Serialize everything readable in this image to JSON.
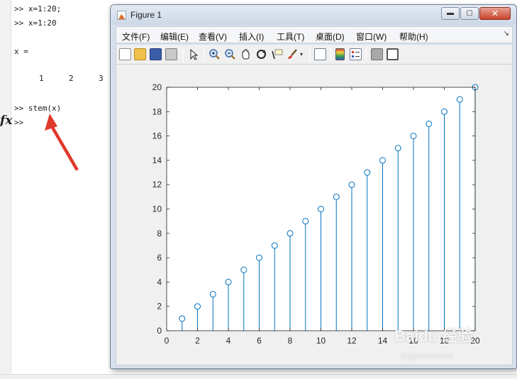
{
  "command_window": {
    "history": [
      ">> x=1:20;",
      ">> x=1:20"
    ],
    "var_label": "x =",
    "columns": [
      "1",
      "2",
      "3"
    ],
    "command": ">> stem(x)",
    "prompt": ">>",
    "fx_symbol": "fx"
  },
  "figure": {
    "title": "Figure 1",
    "min_glyph": "▬",
    "max_glyph": "▢",
    "close_glyph": "✕",
    "menus": [
      "文件(F)",
      "编辑(E)",
      "查看(V)",
      "插入(I)",
      "工具(T)",
      "桌面(D)",
      "窗口(W)",
      "帮助(H)"
    ],
    "dock_glyph": "↘",
    "toolbar_icons": [
      "new-figure-icon",
      "open-file-icon",
      "save-icon",
      "print-icon",
      "pointer-icon",
      "zoom-in-icon",
      "zoom-out-icon",
      "pan-hand-icon",
      "rotate-3d-icon",
      "data-cursor-icon",
      "brush-icon",
      "link-plot-icon",
      "colorbar-icon",
      "legend-icon",
      "hide-tools-icon",
      "show-tools-icon"
    ]
  },
  "watermark": {
    "text": "Baidu 经验",
    "sub": "jingyan.baidu.com"
  },
  "colors": {
    "stem": "#0072BD",
    "arrow": "#e0392b",
    "axes_bg": "#ffffff",
    "figure_bg": "#f0f0f0"
  },
  "chart_data": {
    "type": "stem",
    "title": "",
    "xlabel": "",
    "ylabel": "",
    "x": [
      1,
      2,
      3,
      4,
      5,
      6,
      7,
      8,
      9,
      10,
      11,
      12,
      13,
      14,
      15,
      16,
      17,
      18,
      19,
      20
    ],
    "values": [
      1,
      2,
      3,
      4,
      5,
      6,
      7,
      8,
      9,
      10,
      11,
      12,
      13,
      14,
      15,
      16,
      17,
      18,
      19,
      20
    ],
    "xlim": [
      0,
      20
    ],
    "ylim": [
      0,
      20
    ],
    "xticks": [
      "0",
      "2",
      "4",
      "6",
      "8",
      "10",
      "12",
      "14",
      "16",
      "18",
      "20"
    ],
    "yticks": [
      "0",
      "2",
      "4",
      "6",
      "8",
      "10",
      "12",
      "14",
      "16",
      "18",
      "20"
    ],
    "marker": "circle-open",
    "grid": false,
    "legend": "none"
  }
}
